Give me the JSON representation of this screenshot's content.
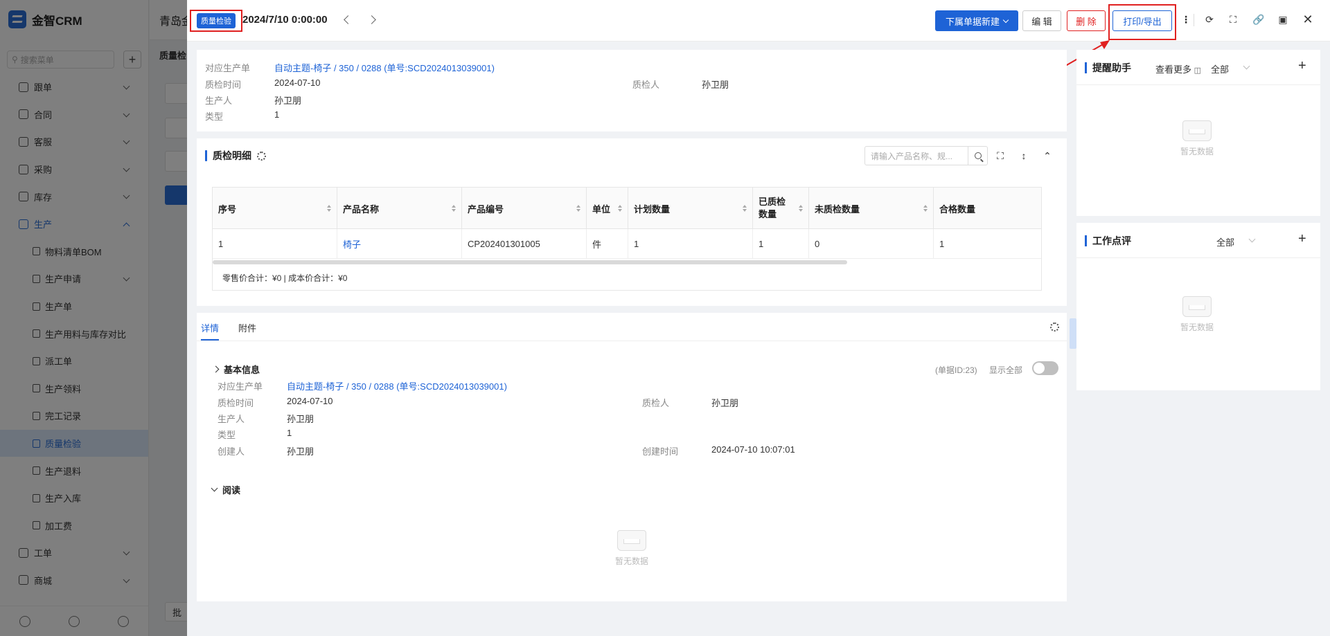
{
  "app": {
    "logo_text": "金智CRM",
    "search_placeholder": "搜索菜单",
    "header_title_partial": "青岛金",
    "sub_title_partial": "质量检",
    "bottom_btn_partial": "批"
  },
  "sidebar": {
    "items": [
      {
        "label": "跟单",
        "type": "group",
        "icon": "user-follow-icon"
      },
      {
        "label": "合同",
        "type": "group",
        "icon": "contract-icon"
      },
      {
        "label": "客服",
        "type": "group",
        "icon": "headset-icon"
      },
      {
        "label": "采购",
        "type": "group",
        "icon": "cart-icon"
      },
      {
        "label": "库存",
        "type": "group",
        "icon": "warehouse-icon"
      },
      {
        "label": "生产",
        "type": "group-open",
        "icon": "factory-icon"
      },
      {
        "label": "物料清单BOM",
        "type": "sub",
        "icon": "list-icon"
      },
      {
        "label": "生产申请",
        "type": "sub-group",
        "icon": "copy-icon"
      },
      {
        "label": "生产单",
        "type": "sub",
        "icon": "doc-list-icon"
      },
      {
        "label": "生产用料与库存对比",
        "type": "sub",
        "icon": "compare-icon"
      },
      {
        "label": "派工单",
        "type": "sub",
        "icon": "person-icon"
      },
      {
        "label": "生产领料",
        "type": "sub",
        "icon": "doc-icon"
      },
      {
        "label": "完工记录",
        "type": "sub",
        "icon": "doc-check-icon"
      },
      {
        "label": "质量检验",
        "type": "sub-active",
        "icon": "shield-check-icon"
      },
      {
        "label": "生产退料",
        "type": "sub",
        "icon": "doc-return-icon"
      },
      {
        "label": "生产入库",
        "type": "sub",
        "icon": "inbox-icon"
      },
      {
        "label": "加工费",
        "type": "sub",
        "icon": "fee-icon"
      },
      {
        "label": "工单",
        "type": "group",
        "icon": "ticket-icon"
      },
      {
        "label": "商城",
        "type": "group",
        "icon": "shop-icon"
      }
    ]
  },
  "drawer": {
    "badge": "质量检验",
    "title_date": "2024/7/10 0:00:00",
    "buttons": {
      "create_sub": "下属单据新建",
      "edit": "编 辑",
      "delete": "删 除",
      "print_export": "打印/导出"
    },
    "info": {
      "production_order_label": "对应生产单",
      "production_order_value": "自动主题-椅子 / 350 / 0288 (单号:SCD2024013039001)",
      "qc_time_label": "质检时间",
      "qc_time_value": "2024-07-10",
      "inspector_label": "质检人",
      "inspector_value": "孙卫朋",
      "producer_label": "生产人",
      "producer_value": "孙卫朋",
      "type_label": "类型",
      "type_value": "1"
    },
    "detail": {
      "title": "质检明细",
      "search_placeholder": "请输入产品名称、规...",
      "columns": [
        "序号",
        "产品名称",
        "产品编号",
        "单位",
        "计划数量",
        "已质检数量",
        "未质检数量",
        "合格数量"
      ],
      "rows": [
        [
          "1",
          "椅子",
          "CP202401301005",
          "件",
          "1",
          "1",
          "0",
          "1"
        ]
      ],
      "footer": "零售价合计：¥0 |   成本价合计：¥0"
    },
    "tabs": {
      "items": [
        "详情",
        "附件"
      ],
      "basic_info_title": "基本信息",
      "doc_id": "(单据ID:23)",
      "show_all": "显示全部",
      "fields": {
        "production_order_label": "对应生产单",
        "production_order_value": "自动主题-椅子 / 350 / 0288 (单号:SCD2024013039001)",
        "qc_time_label": "质检时间",
        "qc_time_value": "2024-07-10",
        "inspector_label": "质检人",
        "inspector_value": "孙卫朋",
        "producer_label": "生产人",
        "producer_value": "孙卫朋",
        "type_label": "类型",
        "type_value": "1",
        "creator_label": "创建人",
        "creator_value": "孙卫朋",
        "created_time_label": "创建时间",
        "created_time_value": "2024-07-10 10:07:01"
      },
      "read_title": "阅读",
      "empty_text": "暂无数据"
    },
    "reminder": {
      "title": "提醒助手",
      "more": "查看更多",
      "filter": "全部",
      "empty_text": "暂无数据"
    },
    "review": {
      "title": "工作点评",
      "filter": "全部",
      "empty_text": "暂无数据"
    }
  },
  "colors": {
    "primary": "#1e63d6",
    "danger": "#e02020",
    "annotation": "#e02020"
  }
}
